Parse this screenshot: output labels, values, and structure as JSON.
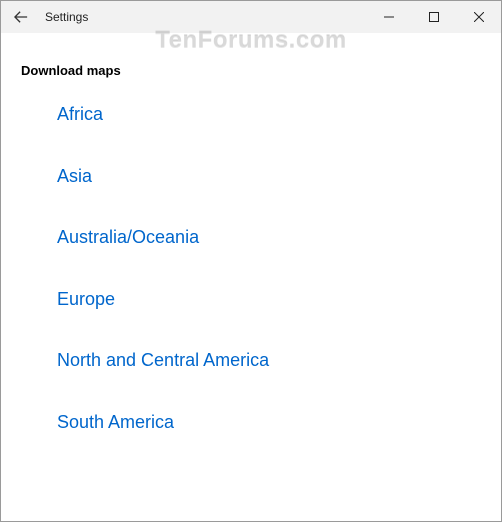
{
  "titlebar": {
    "title": "Settings"
  },
  "heading": "Download maps",
  "regions": {
    "items": [
      {
        "label": "Africa"
      },
      {
        "label": "Asia"
      },
      {
        "label": "Australia/Oceania"
      },
      {
        "label": "Europe"
      },
      {
        "label": "North and Central America"
      },
      {
        "label": "South America"
      }
    ]
  },
  "watermark": "TenForums.com"
}
